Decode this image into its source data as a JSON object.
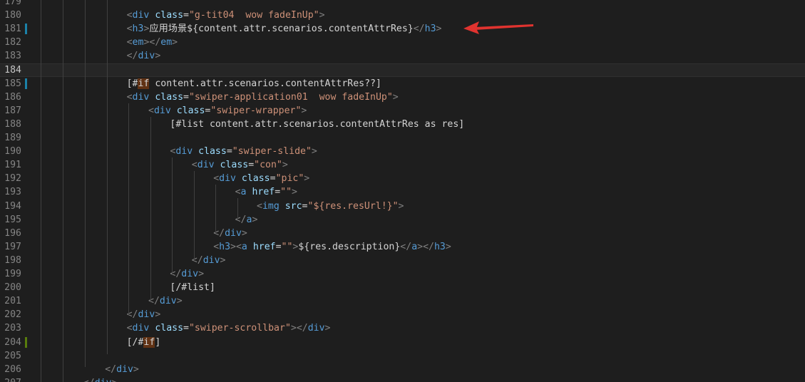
{
  "editor": {
    "colors": {
      "background": "#1e1e1e",
      "line_number": "#858585",
      "tag": "#569cd6",
      "bracket": "#808080",
      "attribute": "#9cdcfe",
      "string": "#ce9178",
      "text": "#d4d4d4",
      "highlight_bg": "#613214",
      "annotation_arrow": "#e0332f"
    },
    "current_line": 184,
    "annotation": {
      "type": "red-arrow-icon",
      "points_to_line": 181
    },
    "lines": [
      {
        "n": "179",
        "tokens": []
      },
      {
        "n": "180",
        "tokens": [
          {
            "t": "<",
            "c": "pun"
          },
          {
            "t": "div",
            "c": "tag"
          },
          {
            "t": " class",
            "c": "att"
          },
          {
            "t": "=",
            "c": "txt"
          },
          {
            "t": "\"g-tit04  wow fadeInUp\"",
            "c": "str"
          },
          {
            "t": ">",
            "c": "pun"
          }
        ]
      },
      {
        "n": "181",
        "mark": "blue",
        "tokens": [
          {
            "t": "<",
            "c": "pun"
          },
          {
            "t": "h3",
            "c": "tag"
          },
          {
            "t": ">",
            "c": "pun"
          },
          {
            "t": "应用场景${content.attr.scenarios.contentAttrRes}",
            "c": "txt"
          },
          {
            "t": "</",
            "c": "pun"
          },
          {
            "t": "h3",
            "c": "tag"
          },
          {
            "t": ">",
            "c": "pun"
          }
        ]
      },
      {
        "n": "182",
        "tokens": [
          {
            "t": "<",
            "c": "pun"
          },
          {
            "t": "em",
            "c": "tag"
          },
          {
            "t": "></",
            "c": "pun"
          },
          {
            "t": "em",
            "c": "tag"
          },
          {
            "t": ">",
            "c": "pun"
          }
        ]
      },
      {
        "n": "183",
        "tokens": [
          {
            "t": "</",
            "c": "pun"
          },
          {
            "t": "div",
            "c": "tag"
          },
          {
            "t": ">",
            "c": "pun"
          }
        ]
      },
      {
        "n": "184",
        "tokens": []
      },
      {
        "n": "185",
        "mark": "blue",
        "tokens": [
          {
            "t": "[#",
            "c": "txt"
          },
          {
            "t": "if",
            "c": "kw"
          },
          {
            "t": " content.attr.scenarios.contentAttrRes??]",
            "c": "txt"
          }
        ]
      },
      {
        "n": "186",
        "tokens": [
          {
            "t": "<",
            "c": "pun"
          },
          {
            "t": "div",
            "c": "tag"
          },
          {
            "t": " class",
            "c": "att"
          },
          {
            "t": "=",
            "c": "txt"
          },
          {
            "t": "\"swiper-application01  wow fadeInUp\"",
            "c": "str"
          },
          {
            "t": ">",
            "c": "pun"
          }
        ]
      },
      {
        "n": "187",
        "tokens": [
          {
            "t": "<",
            "c": "pun"
          },
          {
            "t": "div",
            "c": "tag"
          },
          {
            "t": " class",
            "c": "att"
          },
          {
            "t": "=",
            "c": "txt"
          },
          {
            "t": "\"swiper-wrapper\"",
            "c": "str"
          },
          {
            "t": ">",
            "c": "pun"
          }
        ]
      },
      {
        "n": "188",
        "tokens": [
          {
            "t": "[#list content.attr.scenarios.contentAttrRes as res]",
            "c": "txt"
          }
        ]
      },
      {
        "n": "189",
        "tokens": []
      },
      {
        "n": "190",
        "tokens": [
          {
            "t": "<",
            "c": "pun"
          },
          {
            "t": "div",
            "c": "tag"
          },
          {
            "t": " class",
            "c": "att"
          },
          {
            "t": "=",
            "c": "txt"
          },
          {
            "t": "\"swiper-slide\"",
            "c": "str"
          },
          {
            "t": ">",
            "c": "pun"
          }
        ]
      },
      {
        "n": "191",
        "tokens": [
          {
            "t": "<",
            "c": "pun"
          },
          {
            "t": "div",
            "c": "tag"
          },
          {
            "t": " class",
            "c": "att"
          },
          {
            "t": "=",
            "c": "txt"
          },
          {
            "t": "\"con\"",
            "c": "str"
          },
          {
            "t": ">",
            "c": "pun"
          }
        ]
      },
      {
        "n": "192",
        "tokens": [
          {
            "t": "<",
            "c": "pun"
          },
          {
            "t": "div",
            "c": "tag"
          },
          {
            "t": " class",
            "c": "att"
          },
          {
            "t": "=",
            "c": "txt"
          },
          {
            "t": "\"pic\"",
            "c": "str"
          },
          {
            "t": ">",
            "c": "pun"
          }
        ]
      },
      {
        "n": "193",
        "tokens": [
          {
            "t": "<",
            "c": "pun"
          },
          {
            "t": "a",
            "c": "tag"
          },
          {
            "t": " href",
            "c": "att"
          },
          {
            "t": "=",
            "c": "txt"
          },
          {
            "t": "\"\"",
            "c": "str"
          },
          {
            "t": ">",
            "c": "pun"
          }
        ]
      },
      {
        "n": "194",
        "tokens": [
          {
            "t": "<",
            "c": "pun"
          },
          {
            "t": "img",
            "c": "tag"
          },
          {
            "t": " src",
            "c": "att"
          },
          {
            "t": "=",
            "c": "txt"
          },
          {
            "t": "\"${res.resUrl!}\"",
            "c": "str"
          },
          {
            "t": ">",
            "c": "pun"
          }
        ]
      },
      {
        "n": "195",
        "tokens": [
          {
            "t": "</",
            "c": "pun"
          },
          {
            "t": "a",
            "c": "tag"
          },
          {
            "t": ">",
            "c": "pun"
          }
        ]
      },
      {
        "n": "196",
        "tokens": [
          {
            "t": "</",
            "c": "pun"
          },
          {
            "t": "div",
            "c": "tag"
          },
          {
            "t": ">",
            "c": "pun"
          }
        ]
      },
      {
        "n": "197",
        "tokens": [
          {
            "t": "<",
            "c": "pun"
          },
          {
            "t": "h3",
            "c": "tag"
          },
          {
            "t": "><",
            "c": "pun"
          },
          {
            "t": "a",
            "c": "tag"
          },
          {
            "t": " href",
            "c": "att"
          },
          {
            "t": "=",
            "c": "txt"
          },
          {
            "t": "\"\"",
            "c": "str"
          },
          {
            "t": ">",
            "c": "pun"
          },
          {
            "t": "${res.description}",
            "c": "txt"
          },
          {
            "t": "</",
            "c": "pun"
          },
          {
            "t": "a",
            "c": "tag"
          },
          {
            "t": "></",
            "c": "pun"
          },
          {
            "t": "h3",
            "c": "tag"
          },
          {
            "t": ">",
            "c": "pun"
          }
        ]
      },
      {
        "n": "198",
        "tokens": [
          {
            "t": "</",
            "c": "pun"
          },
          {
            "t": "div",
            "c": "tag"
          },
          {
            "t": ">",
            "c": "pun"
          }
        ]
      },
      {
        "n": "199",
        "tokens": [
          {
            "t": "</",
            "c": "pun"
          },
          {
            "t": "div",
            "c": "tag"
          },
          {
            "t": ">",
            "c": "pun"
          }
        ]
      },
      {
        "n": "200",
        "tokens": [
          {
            "t": "[/#list]",
            "c": "txt"
          }
        ]
      },
      {
        "n": "201",
        "tokens": [
          {
            "t": "</",
            "c": "pun"
          },
          {
            "t": "div",
            "c": "tag"
          },
          {
            "t": ">",
            "c": "pun"
          }
        ]
      },
      {
        "n": "202",
        "tokens": [
          {
            "t": "</",
            "c": "pun"
          },
          {
            "t": "div",
            "c": "tag"
          },
          {
            "t": ">",
            "c": "pun"
          }
        ]
      },
      {
        "n": "203",
        "tokens": [
          {
            "t": "<",
            "c": "pun"
          },
          {
            "t": "div",
            "c": "tag"
          },
          {
            "t": " class",
            "c": "att"
          },
          {
            "t": "=",
            "c": "txt"
          },
          {
            "t": "\"swiper-scrollbar\"",
            "c": "str"
          },
          {
            "t": "></",
            "c": "pun"
          },
          {
            "t": "div",
            "c": "tag"
          },
          {
            "t": ">",
            "c": "pun"
          }
        ]
      },
      {
        "n": "204",
        "mark": "green",
        "tokens": [
          {
            "t": "[/#",
            "c": "txt"
          },
          {
            "t": "if",
            "c": "kw"
          },
          {
            "t": "]",
            "c": "txt"
          }
        ]
      },
      {
        "n": "205",
        "tokens": []
      },
      {
        "n": "206",
        "tokens": [
          {
            "t": "</",
            "c": "pun"
          },
          {
            "t": "div",
            "c": "tag"
          },
          {
            "t": ">",
            "c": "pun"
          }
        ]
      },
      {
        "n": "207",
        "tokens": [
          {
            "t": "</",
            "c": "pun"
          },
          {
            "t": "div",
            "c": "tag"
          },
          {
            "t": ">",
            "c": "pun"
          }
        ]
      }
    ]
  }
}
